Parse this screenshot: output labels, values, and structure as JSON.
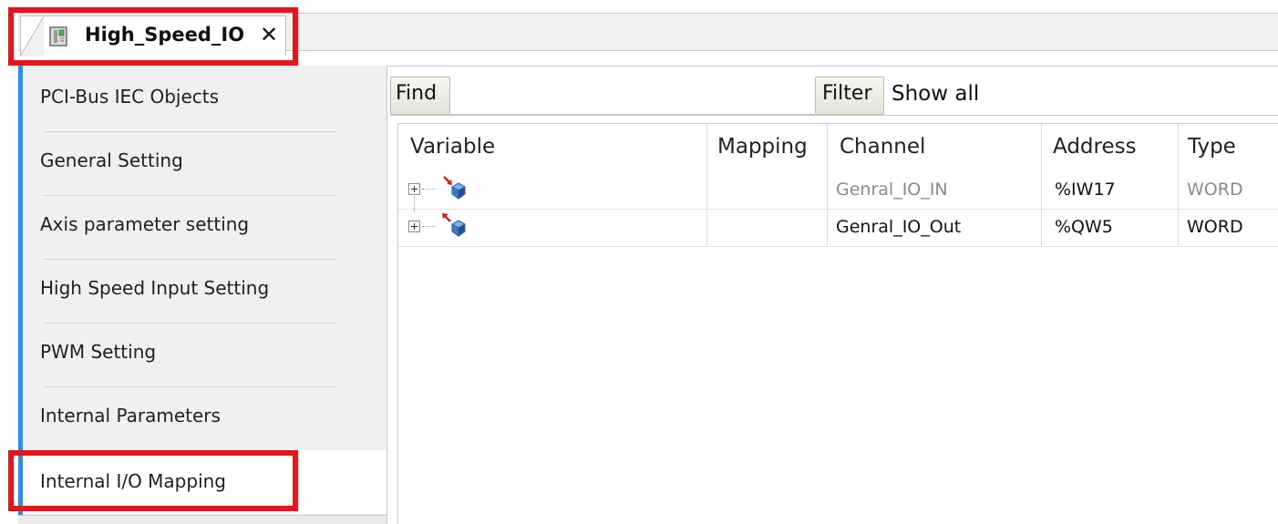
{
  "window": {
    "tab_title": "High_Speed_IO",
    "tab_close": "✕",
    "tab_icon": "device-icon"
  },
  "sidebar": {
    "items": [
      {
        "label": "PCI-Bus IEC Objects",
        "active": false
      },
      {
        "label": "General Setting",
        "active": false
      },
      {
        "label": "Axis parameter setting",
        "active": false
      },
      {
        "label": "High Speed Input Setting",
        "active": false
      },
      {
        "label": "PWM Setting",
        "active": false
      },
      {
        "label": "Internal Parameters",
        "active": false
      },
      {
        "label": "Internal I/O Mapping",
        "active": true
      }
    ]
  },
  "toolbar": {
    "find_label": "Find",
    "find_value": "",
    "filter_label": "Filter",
    "filter_value": "Show all"
  },
  "table": {
    "columns": [
      "Variable",
      "Mapping",
      "Channel",
      "Address",
      "Type"
    ],
    "rows": [
      {
        "variable": "",
        "mapping": "",
        "channel": "Genral_IO_IN",
        "address": "%IW17",
        "type": "WORD",
        "icon": "input-variable-icon",
        "dimmed": true
      },
      {
        "variable": "",
        "mapping": "",
        "channel": "Genral_IO_Out",
        "address": "%QW5",
        "type": "WORD",
        "icon": "output-variable-icon",
        "dimmed": false
      }
    ]
  },
  "colors": {
    "highlight": "#e8131b",
    "accent": "#2f8de4"
  }
}
